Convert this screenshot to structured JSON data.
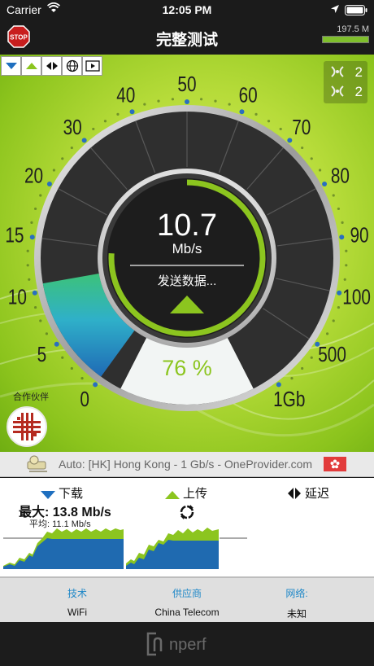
{
  "status_bar": {
    "carrier": "Carrier",
    "time": "12:05 PM"
  },
  "header": {
    "title": "完整测试",
    "stop_label": "STOP",
    "data_usage": "197.5 M"
  },
  "mode_buttons": [
    "download-icon",
    "upload-icon",
    "latency-icon",
    "browse-icon",
    "video-icon"
  ],
  "counters": [
    {
      "icon": "wifi-wave-icon",
      "value": "2"
    },
    {
      "icon": "wifi-wave-icon",
      "value": "2"
    }
  ],
  "gauge": {
    "scale_labels": [
      "0",
      "5",
      "10",
      "15",
      "20",
      "30",
      "40",
      "50",
      "60",
      "70",
      "80",
      "90",
      "100",
      "500",
      "1Gb"
    ],
    "speed": "10.7",
    "unit": "Mb/s",
    "status": "发送数据...",
    "progress_label": "76 %",
    "progress": 0.76,
    "fill_level_mbps": 10.7,
    "accent": "#8cc51f"
  },
  "partner": {
    "label": "合作伙伴"
  },
  "server": {
    "text": "Auto: [HK] Hong Kong - 1 Gb/s - OneProvider.com",
    "flag_color": "#e23b3b"
  },
  "results": {
    "download": {
      "label": "下载",
      "max": "最大: 13.8 Mb/s",
      "avg": "平均: 11.1 Mb/s"
    },
    "upload": {
      "label": "上传"
    },
    "latency": {
      "label": "延迟"
    }
  },
  "info": [
    {
      "label": "技术",
      "value": "WiFi"
    },
    {
      "label": "供应商",
      "value": "China Telecom"
    },
    {
      "label": "网络:",
      "value": "未知"
    }
  ],
  "footer": {
    "brand": "nperf"
  }
}
